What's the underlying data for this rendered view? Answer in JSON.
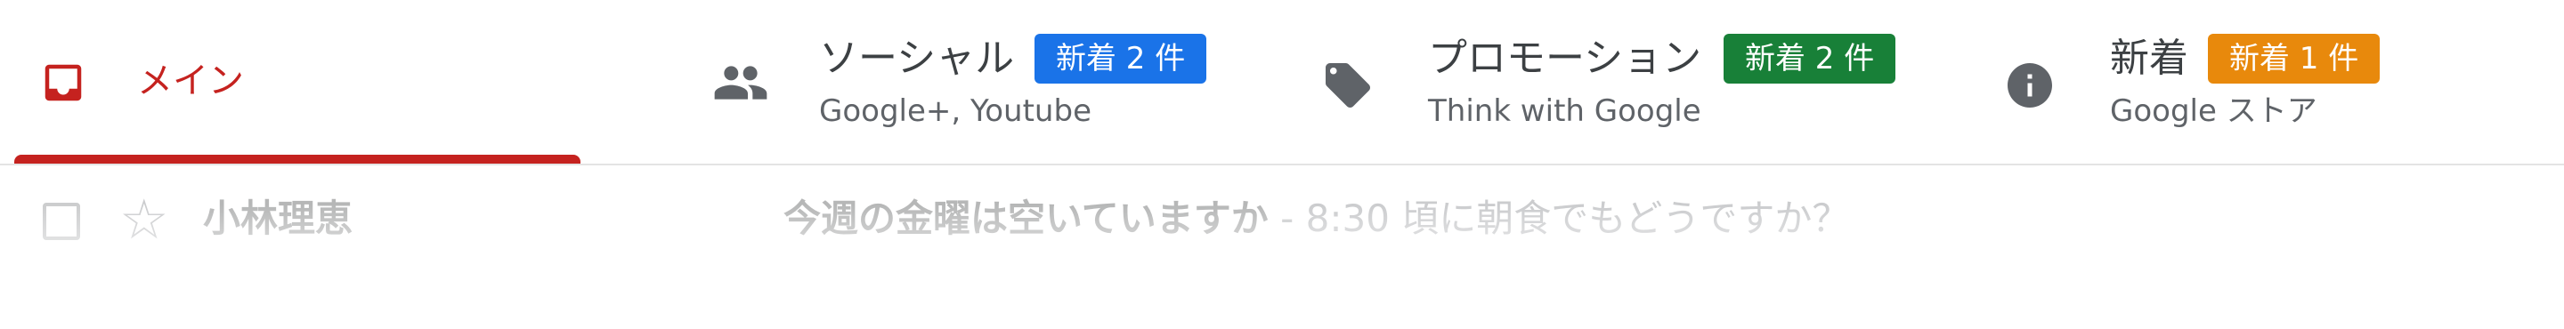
{
  "colors": {
    "primary_accent": "#c5221f",
    "social_badge": "#1a73e8",
    "promotions_badge": "#188038",
    "updates_badge": "#e8890c",
    "icon_gray": "#5f6368"
  },
  "tabs": {
    "primary": {
      "label": "メイン",
      "icon": "inbox-icon",
      "selected": true
    },
    "social": {
      "label": "ソーシャル",
      "subtitle": "Google+, Youtube",
      "badge": "新着 2 件",
      "icon": "people-icon"
    },
    "promotions": {
      "label": "プロモーション",
      "subtitle": "Think with Google",
      "badge": "新着 2 件",
      "icon": "tag-icon"
    },
    "updates": {
      "label": "新着",
      "subtitle": "Google ストア",
      "badge": "新着 1 件",
      "icon": "info-icon"
    }
  },
  "email_row": {
    "sender": "小林理恵",
    "subject": "今週の金曜は空いていますか",
    "separator": " - ",
    "snippet": "8:30 頃に朝食でもどうですか？",
    "star_glyph": "☆"
  }
}
